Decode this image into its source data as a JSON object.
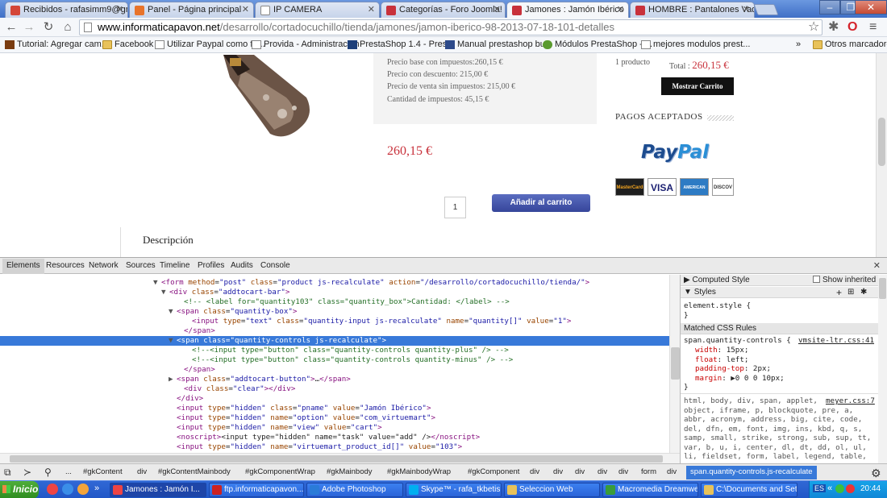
{
  "browser": {
    "tabs": [
      {
        "label": "Recibidos - rafasimm9@gmail",
        "color": "#d44638"
      },
      {
        "label": "Panel - Página principal",
        "color": "#e8732a"
      },
      {
        "label": "IP CAMERA",
        "color": "#ffffff"
      },
      {
        "label": "Categorías - Foro Joomla! - P",
        "color": "#c8313b"
      },
      {
        "label": "Jamones : Jamón Ibérico",
        "color": "#c8313b"
      },
      {
        "label": "HOMBRE : Pantalones Vaqu",
        "color": "#c8313b"
      }
    ],
    "url_host": "www.informaticapavon.net",
    "url_path": "/desarrollo/cortadocuchillo/tienda/jamones/jamon-iberico-98-2013-07-18-101-detalles",
    "bookmarks": [
      "Tutorial: Agregar cam...",
      "Facebook",
      "Utilizar Paypal como fo...",
      "Provida - Administración",
      "PrestaShop 1.4 - Pres...",
      "Manual prestashop bu...",
      "Módulos PrestaShop - ...",
      "mejores modulos prest..."
    ],
    "bookmarks_more": "»",
    "other_bookmarks": "Otros marcadores"
  },
  "product": {
    "price_lines": [
      "Precio base con impuestos:260,15 €",
      "Precio con descuento: 215,00 €",
      "Precio de venta sin impuestos: 215,00 €",
      "Cantidad de impuestos: 45,15 €"
    ],
    "sale_price": "260,15 €",
    "quantity": "1",
    "add_to_cart": "Añadir al carrito",
    "description_heading": "Descripción"
  },
  "cart": {
    "count": "1 producto",
    "total_label": "Total :",
    "total_value": "260,15 €",
    "show_cart": "Mostrar Carrito",
    "payments_heading": "PAGOS ACEPTADOS",
    "paypal_pay": "Pay",
    "paypal_pal": "Pal",
    "cards": [
      "MasterCard",
      "VISA",
      "AMERICAN",
      "DISCOV"
    ]
  },
  "devtools": {
    "tabs": [
      "Elements",
      "Resources",
      "Network",
      "Sources",
      "Timeline",
      "Profiles",
      "Audits",
      "Console"
    ],
    "dom": [
      {
        "indent": 190,
        "tri": "▼",
        "html": "<span class=\"tg\">&lt;form</span> <span class=\"an\">method</span>=<span class=\"av\">\"post\"</span> <span class=\"an\">class</span>=<span class=\"av\">\"product js-recalculate\"</span> <span class=\"an\">action</span>=<span class=\"av\">\"/desarrollo/cortadocuchillo/tienda/\"</span><span class=\"tg\">&gt;</span>"
      },
      {
        "indent": 200,
        "tri": "▼",
        "html": "<span class=\"tg\">&lt;div</span> <span class=\"an\">class</span>=<span class=\"av\">\"addtocart-bar\"</span><span class=\"tg\">&gt;</span>"
      },
      {
        "indent": 218,
        "tri": "",
        "html": "<span class=\"cm\">&lt;!-- &lt;label for=\"quantity103\" class=\"quantity_box\"&gt;Cantidad: &lt;/label&gt; --&gt;</span>"
      },
      {
        "indent": 209,
        "tri": "▼",
        "html": "<span class=\"tg\">&lt;span</span> <span class=\"an\">class</span>=<span class=\"av\">\"quantity-box\"</span><span class=\"tg\">&gt;</span>"
      },
      {
        "indent": 228,
        "tri": "",
        "html": "<span class=\"tg\">&lt;input</span> <span class=\"an\">type</span>=<span class=\"av\">\"text\"</span> <span class=\"an\">class</span>=<span class=\"av\">\"quantity-input js-recalculate\"</span> <span class=\"an\">name</span>=<span class=\"av\">\"quantity[]\"</span> <span class=\"an\">value</span>=<span class=\"av\">\"1\"</span><span class=\"tg\">&gt;</span>"
      },
      {
        "indent": 218,
        "tri": "",
        "html": "<span class=\"tg\">&lt;/span&gt;</span>"
      },
      {
        "indent": 209,
        "tri": "▼",
        "sel": true,
        "html": "<span class=\"tg\">&lt;span</span> <span class=\"an\">class</span>=<span class=\"av\">\"quantity-controls js-recalculate\"</span><span class=\"tg\">&gt;</span>"
      },
      {
        "indent": 228,
        "tri": "",
        "html": "<span class=\"cm\">&lt;!--&lt;input type=\"button\" class=\"quantity-controls quantity-plus\" /&gt; --&gt;</span>"
      },
      {
        "indent": 228,
        "tri": "",
        "html": "<span class=\"cm\">&lt;!--&lt;input type=\"button\" class=\"quantity-controls quantity-minus\" /&gt; --&gt;</span>"
      },
      {
        "indent": 218,
        "tri": "",
        "html": "<span class=\"tg\">&lt;/span&gt;</span>"
      },
      {
        "indent": 209,
        "tri": "▶",
        "html": "<span class=\"tg\">&lt;span</span> <span class=\"an\">class</span>=<span class=\"av\">\"addtocart-button\"</span><span class=\"tg\">&gt;</span><span class=\"tx\">…</span><span class=\"tg\">&lt;/span&gt;</span>"
      },
      {
        "indent": 218,
        "tri": "",
        "html": "<span class=\"tg\">&lt;div</span> <span class=\"an\">class</span>=<span class=\"av\">\"clear\"</span><span class=\"tg\">&gt;&lt;/div&gt;</span>"
      },
      {
        "indent": 209,
        "tri": "",
        "html": "<span class=\"tg\">&lt;/div&gt;</span>"
      },
      {
        "indent": 209,
        "tri": "",
        "html": "<span class=\"tg\">&lt;input</span> <span class=\"an\">type</span>=<span class=\"av\">\"hidden\"</span> <span class=\"an\">class</span>=<span class=\"av\">\"pname\"</span> <span class=\"an\">value</span>=<span class=\"av\">\"Jamón Ibérico\"</span><span class=\"tg\">&gt;</span>"
      },
      {
        "indent": 209,
        "tri": "",
        "html": "<span class=\"tg\">&lt;input</span> <span class=\"an\">type</span>=<span class=\"av\">\"hidden\"</span> <span class=\"an\">name</span>=<span class=\"av\">\"option\"</span> <span class=\"an\">value</span>=<span class=\"av\">\"com_virtuemart\"</span><span class=\"tg\">&gt;</span>"
      },
      {
        "indent": 209,
        "tri": "",
        "html": "<span class=\"tg\">&lt;input</span> <span class=\"an\">type</span>=<span class=\"av\">\"hidden\"</span> <span class=\"an\">name</span>=<span class=\"av\">\"view\"</span> <span class=\"an\">value</span>=<span class=\"av\">\"cart\"</span><span class=\"tg\">&gt;</span>"
      },
      {
        "indent": 209,
        "tri": "",
        "html": "<span class=\"tg\">&lt;noscript&gt;</span><span class=\"tx\">&lt;input type=\"hidden\" name=\"task\" value=\"add\" /&gt;</span><span class=\"tg\">&lt;/noscript&gt;</span>"
      },
      {
        "indent": 209,
        "tri": "",
        "html": "<span class=\"tg\">&lt;input</span> <span class=\"an\">type</span>=<span class=\"av\">\"hidden\"</span> <span class=\"an\">name</span>=<span class=\"av\">\"virtuemart_product_id[]\"</span> <span class=\"an\">value</span>=<span class=\"av\">\"103\"</span><span class=\"tg\">&gt;</span>"
      }
    ],
    "styles": {
      "computed_style": "Computed Style",
      "show_inherited": "Show inherited",
      "styles_heading": "Styles",
      "element_style": "element.style {",
      "brace_close": "}",
      "matched_rules": "Matched CSS Rules",
      "rule_selector": "span.quantity-controls {",
      "rule_source": "vmsite-ltr.css:41",
      "props": [
        {
          "name": "width",
          "value": "15px;"
        },
        {
          "name": "float",
          "value": "left;"
        },
        {
          "name": "padding-top",
          "value": "2px;"
        },
        {
          "name": "margin",
          "value": "▶0 0 0 10px;"
        }
      ],
      "ua_source": "meyer.css:7",
      "ua_lines": [
        "html, body, div, span, applet,",
        "object, iframe, p, blockquote, pre, a,",
        "abbr, acronym, address, big, cite, code,",
        "del, dfn, em, font, img, ins, kbd, q, s,",
        "samp, small, strike, strong, sub, sup, tt,",
        "var, b, u, i, center, dl, dt, dd, ol, ul,",
        "li, fieldset, form, label, legend, table,"
      ]
    },
    "breadcrumbs": [
      "#gkContent",
      "div",
      "#gkContentMainbody",
      "#gkComponentWrap",
      "#gkMainbody",
      "#gkMainbodyWrap",
      "#gkComponent",
      "div",
      "div",
      "div",
      "div",
      "div",
      "form",
      "div"
    ],
    "selected_crumb": "span.quantity-controls.js-recalculate"
  },
  "taskbar": {
    "start": "Inicio",
    "tasks": [
      "Jamones : Jamón I...",
      "ftp.informaticapavon....",
      "Adobe Photoshop",
      "Skype™ - rafa_tkbetis...",
      "Seleccion Web",
      "Macromedia Dreamwe...",
      "C:\\Documents and Set..."
    ],
    "lang": "ES",
    "clock": "20:44"
  }
}
